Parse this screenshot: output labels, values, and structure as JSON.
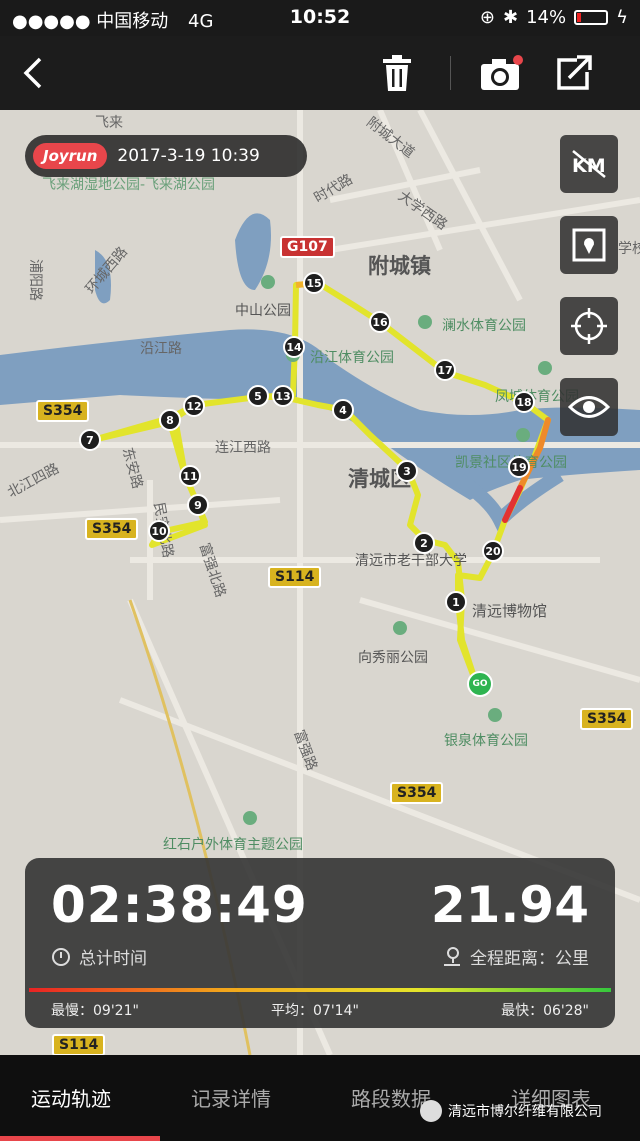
{
  "status_bar": {
    "signal": "●●●●● 中国移动",
    "network": "4G",
    "time": "10:52",
    "battery": "14%",
    "battery_level": 0.14
  },
  "toolbar": {
    "back_icon": "chevron-left-icon",
    "delete_icon": "trash-icon",
    "camera_icon": "camera-icon",
    "share_icon": "share-icon"
  },
  "run": {
    "brand": "Joyrun",
    "datetime": "2017-3-19 10:39"
  },
  "map": {
    "places": {
      "feilai_top": "飞来",
      "feilai_park": "飞来湖湿地公园-飞来湖公园",
      "fucheng_road": "附城大道",
      "shidai_road": "时代路",
      "daxue_road": "大学西路",
      "pufu_road": "浦阳路",
      "huancheng_road": "环城西路",
      "fucheng_town": "附城镇",
      "zhongshan_park": "中山公园",
      "lanshui_park": "澜水体育公园",
      "yanjiang_road": "沿江路",
      "yanjiang_park": "沿江体育公园",
      "fengcheng_park": "凤城体育公园",
      "kaijing_park": "凯景社区体育公园",
      "qingcheng_district": "清城区",
      "lianjiang_road": "连江西路",
      "beijiang_road": "北江四路",
      "anlu": "东安路",
      "minan_road": "民安北路",
      "fuqiang_north": "富强北路",
      "ganbu_college": "清远市老干部大学",
      "museum": "清远博物馆",
      "xiangxiu_park": "向秀丽公园",
      "yinquan_park": "银泉体育公园",
      "fuqiang_road": "富强路",
      "hongshihu_park": "红石户外体育主题公园",
      "xuexiao": "学校"
    },
    "shields": {
      "g107": "G107",
      "s354_a": "S354",
      "s354_b": "S354",
      "s114": "S114",
      "s354_c": "S354",
      "s354_d": "S354",
      "s114_b": "S114"
    },
    "km_markers": [
      "1",
      "2",
      "3",
      "4",
      "5",
      "7",
      "8",
      "9",
      "10",
      "11",
      "12",
      "13",
      "14",
      "15",
      "16",
      "17",
      "18",
      "19",
      "20"
    ],
    "start_label": "GO",
    "side_buttons": [
      "km-toggle-icon",
      "map-style-icon",
      "locate-icon",
      "eye-icon"
    ]
  },
  "stats": {
    "duration": "02:38:49",
    "duration_label": "总计时间",
    "distance": "21.94",
    "distance_label": "全程距离：公里",
    "slowest": "最慢：09'21\"",
    "average": "平均：07'14\"",
    "fastest": "最快：06'28\""
  },
  "tabs": [
    "运动轨迹",
    "记录详情",
    "路段数据",
    "详细图表"
  ],
  "watermark": "清远市博尔纤维有限公司",
  "colors": {
    "brand": "#e8464b",
    "track": "#e2e42c",
    "river": "#7f9fc0",
    "go": "#2eb450"
  }
}
